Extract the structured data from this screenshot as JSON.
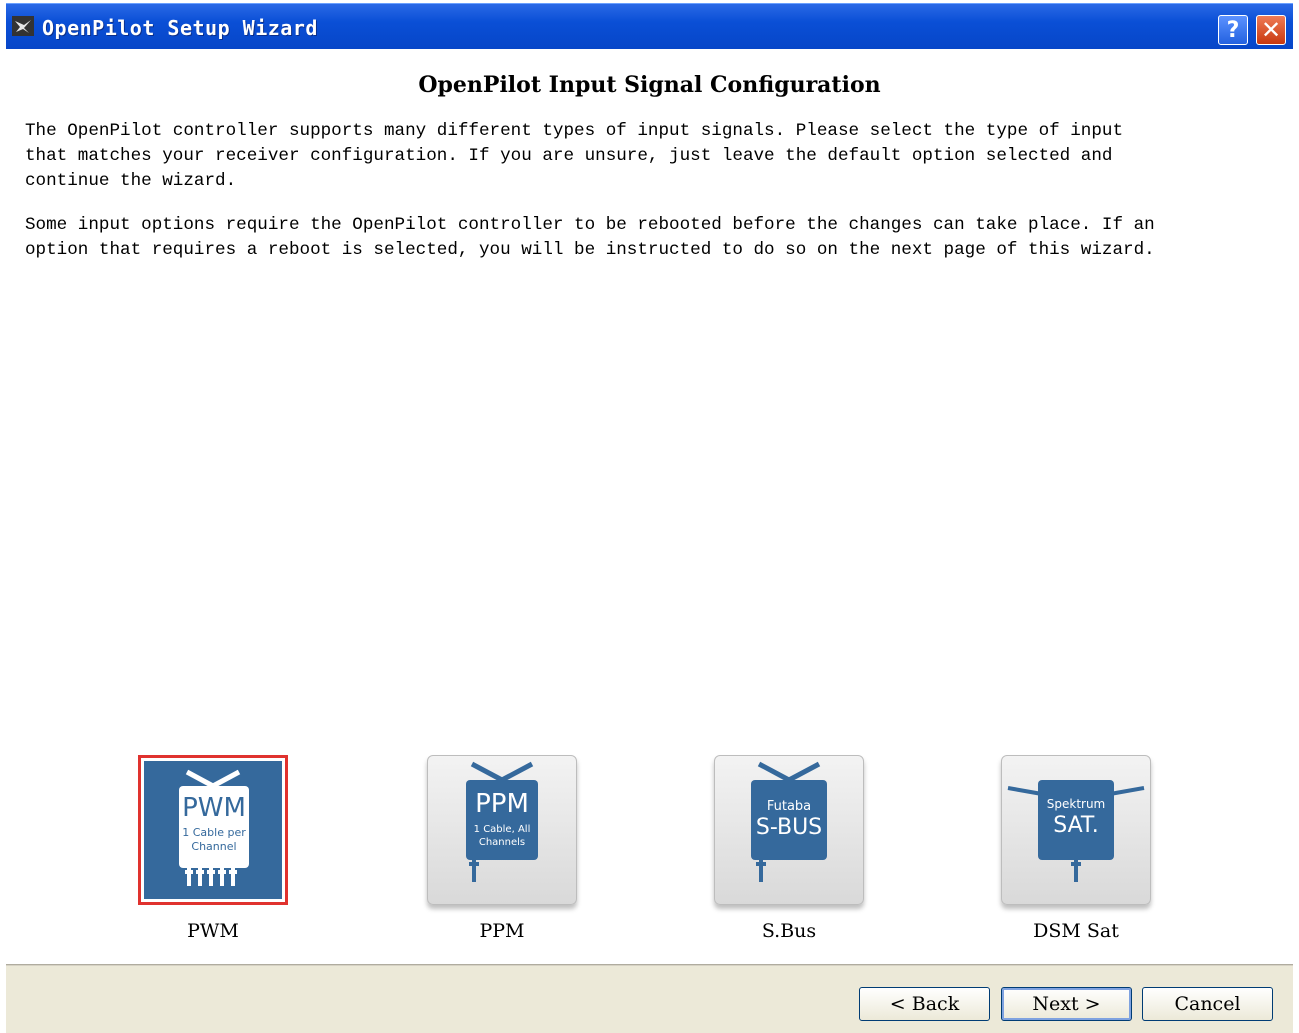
{
  "window": {
    "title": "OpenPilot Setup Wizard",
    "help_label": "?",
    "close_label": "✕"
  },
  "page": {
    "heading": "OpenPilot Input Signal Configuration",
    "paragraph1": "The OpenPilot controller supports many different types of input signals. Please select the type of input\nthat matches your receiver configuration. If you are unsure, just leave the default option selected and\ncontinue the wizard.",
    "paragraph2": "Some input options require the OpenPilot controller to be rebooted before the changes can take place. If an\noption that requires a reboot is selected, you will be instructed to do so on the next page of this wizard."
  },
  "options": [
    {
      "label": "PWM",
      "icon_title": "PWM",
      "icon_sub": "1 Cable per",
      "icon_sub2": "Channel",
      "selected": true
    },
    {
      "label": "PPM",
      "icon_title": "PPM",
      "icon_sub": "1 Cable, All",
      "icon_sub2": "Channels",
      "selected": false
    },
    {
      "label": "S.Bus",
      "icon_title": "S-BUS",
      "icon_sub": "Futaba",
      "selected": false
    },
    {
      "label": "DSM Sat",
      "icon_title": "SAT.",
      "icon_sub": "Spektrum",
      "selected": false
    }
  ],
  "footer": {
    "back_label": "< Back",
    "next_label": "Next >",
    "cancel_label": "Cancel"
  },
  "colors": {
    "titlebar": "#0a4fd6",
    "icon_blue": "#35699c",
    "selection": "#e0322e",
    "footer_bg": "#ece9d8"
  }
}
